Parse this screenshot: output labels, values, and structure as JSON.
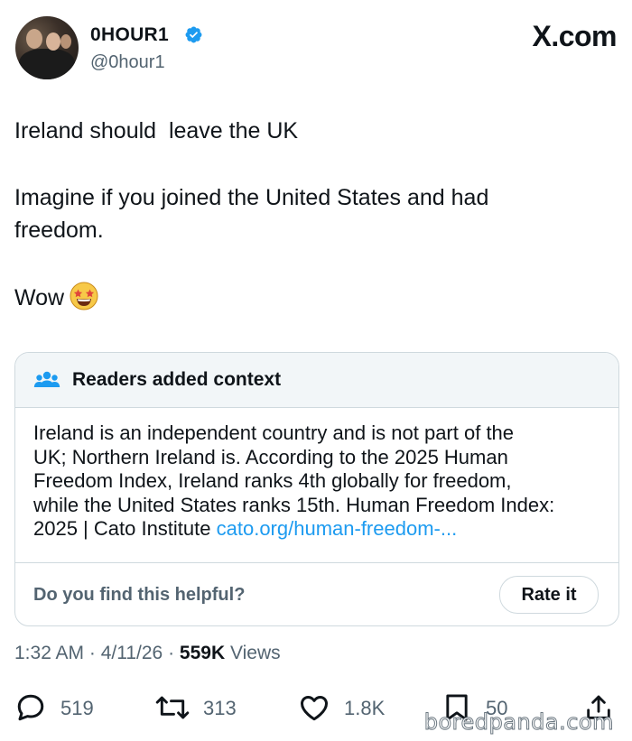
{
  "author": {
    "display_name": "0HOUR1",
    "handle": "@0hour1",
    "verified": true
  },
  "brand": "X.com",
  "tweet": {
    "lines": [
      "Ireland should  leave the UK",
      "Imagine if you joined the United States and had",
      "freedom.",
      "Wow"
    ],
    "emoji": "star-struck-emoji"
  },
  "context": {
    "title": "Readers added context",
    "body_lines": [
      "Ireland is an independent country and is not part of the",
      "UK; Northern Ireland is. According to the 2025 Human",
      "Freedom Index, Ireland ranks 4th globally for freedom,",
      "while the United States ranks 15th. Human Freedom Index:"
    ],
    "last_line_text": "2025 | Cato Institute ",
    "link_text": "cato.org/human-freedom-...",
    "helpful_question": "Do you find this helpful?",
    "rate_button": "Rate it"
  },
  "meta": {
    "time": "1:32 AM",
    "date": "4/11/26",
    "views_count": "559K",
    "views_label": "Views"
  },
  "actions": {
    "replies": "519",
    "reposts": "313",
    "likes": "1.8K",
    "bookmarks": "50"
  },
  "watermark": "boredpanda.com",
  "colors": {
    "text": "#0f1419",
    "muted": "#536471",
    "link": "#1d9bf0",
    "verified": "#1d9bf0",
    "border": "#cfd9de",
    "context_header_bg": "#f2f6f8"
  }
}
